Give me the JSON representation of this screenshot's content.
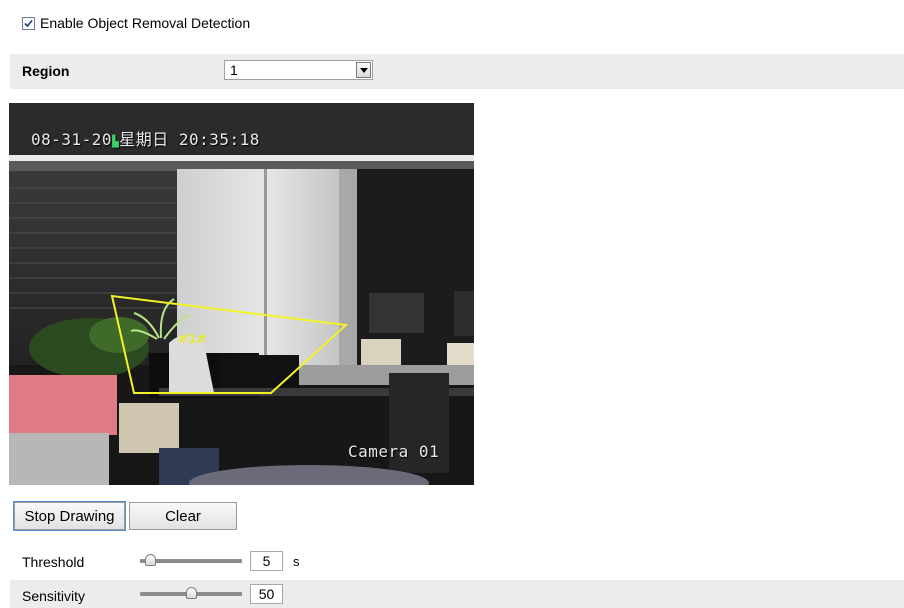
{
  "enable_checkbox": {
    "label": "Enable Object Removal Detection",
    "checked": true
  },
  "region": {
    "label": "Region",
    "value": "1",
    "icon": "chevron-down-icon"
  },
  "video": {
    "timestamp": "08-31-20",
    "date_suffix": "星期日",
    "time": "20:35:18",
    "camera": "Camera 01",
    "roi_label": "#1#",
    "roi_color": "#f2f229"
  },
  "buttons": {
    "stop_drawing": "Stop Drawing",
    "clear": "Clear"
  },
  "threshold": {
    "label": "Threshold",
    "value": "5",
    "unit": "s",
    "slider_fraction": 0.05
  },
  "sensitivity": {
    "label": "Sensitivity",
    "value": "50",
    "slider_fraction": 0.5
  }
}
